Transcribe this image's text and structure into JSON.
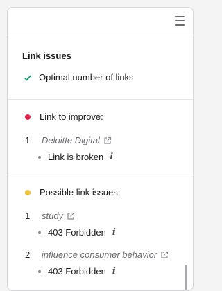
{
  "panel": {
    "title": "Link issues",
    "optimal": {
      "label": "Optimal number of links"
    },
    "improve": {
      "label": "Link to improve:",
      "items": [
        {
          "index": "1",
          "link": "Deloitte Digital",
          "issue": "Link is broken"
        }
      ]
    },
    "possible": {
      "label": "Possible link issues:",
      "items": [
        {
          "index": "1",
          "link": "study",
          "issue": "403 Forbidden"
        },
        {
          "index": "2",
          "link": "influence consumer behavior",
          "issue": "403 Forbidden"
        }
      ]
    }
  },
  "icons": {
    "menu": "hamburger-menu-icon",
    "check": "checkmark-icon",
    "external": "external-link-icon",
    "info": "info-icon"
  },
  "colors": {
    "check": "#0f9f6e",
    "error_dot": "#e5264d",
    "warning_dot": "#f0c23a"
  }
}
